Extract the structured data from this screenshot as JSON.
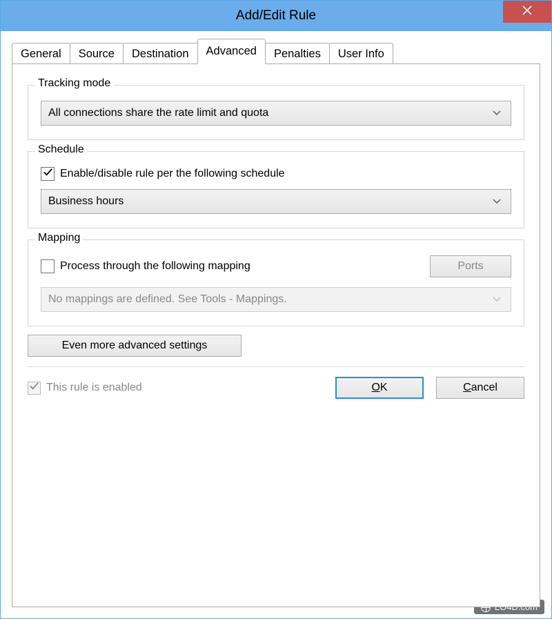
{
  "window": {
    "title": "Add/Edit Rule"
  },
  "tabs": [
    {
      "label": "General"
    },
    {
      "label": "Source"
    },
    {
      "label": "Destination"
    },
    {
      "label": "Advanced"
    },
    {
      "label": "Penalties"
    },
    {
      "label": "User Info"
    }
  ],
  "active_tab_index": 3,
  "tracking": {
    "legend": "Tracking mode",
    "selected": "All connections share the rate limit and quota"
  },
  "schedule": {
    "legend": "Schedule",
    "checkbox_label": "Enable/disable rule per the following schedule",
    "checked": true,
    "selected": "Business hours"
  },
  "mapping": {
    "legend": "Mapping",
    "checkbox_label": "Process through the following mapping",
    "checked": false,
    "ports_button": "Ports",
    "disabled_text": "No mappings are defined. See Tools - Mappings."
  },
  "advanced_button": "Even more advanced settings",
  "footer": {
    "enabled_label": "This rule is enabled",
    "enabled_checked": true,
    "ok": "OK",
    "ok_mnemonic_index": 0,
    "cancel": "Cancel",
    "cancel_mnemonic_index": 0
  },
  "watermark": "LO4D.com"
}
